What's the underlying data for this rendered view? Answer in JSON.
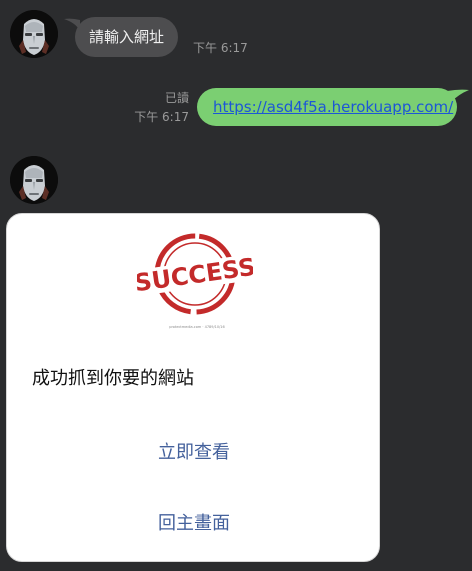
{
  "messages": {
    "incoming": {
      "text": "請輸入網址",
      "time": "下午 6:17"
    },
    "outgoing": {
      "link": "https://asd4f5a.herokuapp.com/",
      "read_label": "已讀",
      "time": "下午 6:17"
    }
  },
  "card": {
    "hero_text": "SUCCESS",
    "hero_caption": "protectmedia.com · 4789/10/16",
    "body_text": "成功抓到你要的網站",
    "actions": [
      {
        "label": "立即查看"
      },
      {
        "label": "回主畫面"
      }
    ]
  },
  "icons": {
    "bot_avatar": "robot-face-icon",
    "hero_image": "success-stamp-icon"
  },
  "colors": {
    "background": "#2b2c2e",
    "incoming_bubble": "#4d4d4f",
    "outgoing_bubble": "#7bcf72",
    "link": "#1c56d6",
    "card_action": "#44619c",
    "stamp_red": "#c32a2a"
  }
}
